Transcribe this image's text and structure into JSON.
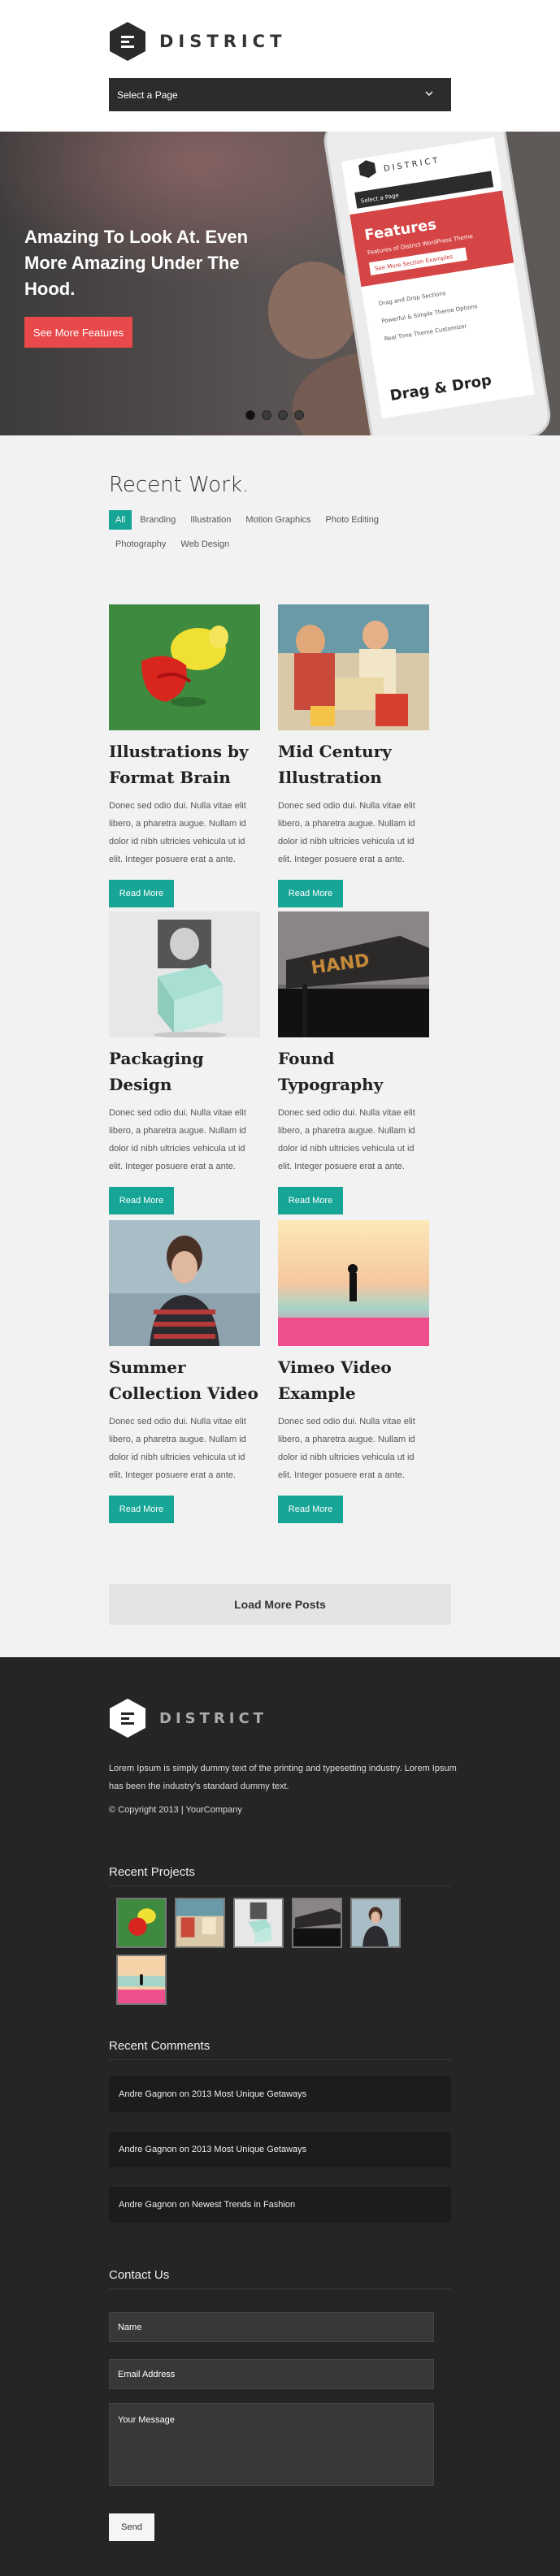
{
  "header": {
    "logo_text": "DISTRICT",
    "page_select": "Select a Page"
  },
  "hero": {
    "title": "Amazing To Look At. Even More Amazing Under The Hood.",
    "button": "See More Features",
    "phone": {
      "brand": "DISTRICT",
      "select": "Select a Page",
      "heading": "Features",
      "subheading": "Features of District WordPress Theme",
      "button": "See More Section Examples",
      "list": [
        "Drag and Drop Sections",
        "Powerful & Simple Theme Options",
        "Real Time Theme Customizer"
      ],
      "footer": "Drag & Drop"
    },
    "slide_count": 4,
    "active_slide": 1
  },
  "works": {
    "title": "Recent Work.",
    "filters": [
      "All",
      "Branding",
      "Illustration",
      "Motion Graphics",
      "Photo Editing",
      "Photography",
      "Web Design"
    ],
    "active_filter": "All",
    "items": [
      {
        "title": "Illustrations by Format Brain",
        "excerpt": "Donec sed odio dui. Nulla vitae elit libero, a pharetra augue. Nullam id dolor id nibh ultricies vehicula ut id elit. Integer posuere erat a ante.",
        "button": "Read More"
      },
      {
        "title": "Mid Century Illustration",
        "excerpt": "Donec sed odio dui. Nulla vitae elit libero, a pharetra augue. Nullam id dolor id nibh ultricies vehicula ut id elit. Integer posuere erat a ante.",
        "button": "Read More"
      },
      {
        "title": "Packaging Design",
        "excerpt": "Donec sed odio dui. Nulla vitae elit libero, a pharetra augue. Nullam id dolor id nibh ultricies vehicula ut id elit. Integer posuere erat a ante.",
        "button": "Read More"
      },
      {
        "title": "Found Typography",
        "excerpt": "Donec sed odio dui. Nulla vitae elit libero, a pharetra augue. Nullam id dolor id nibh ultricies vehicula ut id elit. Integer posuere erat a ante.",
        "button": "Read More",
        "sign_text": "HAND"
      },
      {
        "title": "Summer Collection Video",
        "excerpt": "Donec sed odio dui. Nulla vitae elit libero, a pharetra augue. Nullam id dolor id nibh ultricies vehicula ut id elit. Integer posuere erat a ante.",
        "button": "Read More"
      },
      {
        "title": "Vimeo Video Example",
        "excerpt": "Donec sed odio dui. Nulla vitae elit libero, a pharetra augue. Nullam id dolor id nibh ultricies vehicula ut id elit. Integer posuere erat a ante.",
        "button": "Read More"
      }
    ],
    "load_more": "Load More Posts"
  },
  "footer": {
    "logo_text": "DISTRICT",
    "about": "Lorem Ipsum is simply dummy text of the printing and typesetting industry. Lorem Ipsum has been the industry's standard dummy text.",
    "copyright": "© Copyright 2013 | YourCompany",
    "recent_projects_title": "Recent Projects",
    "recent_comments_title": "Recent Comments",
    "comments": [
      "Andre Gagnon on 2013 Most Unique Getaways",
      "Andre Gagnon on 2013 Most Unique Getaways",
      "Andre Gagnon on Newest Trends in Fashion"
    ],
    "contact_title": "Contact Us",
    "name_placeholder": "Name",
    "email_placeholder": "Email Address",
    "message_placeholder": "Your Message",
    "send": "Send"
  },
  "colors": {
    "accent": "#16a596",
    "hero_button": "#e8494a",
    "footer_bg": "#252525"
  }
}
